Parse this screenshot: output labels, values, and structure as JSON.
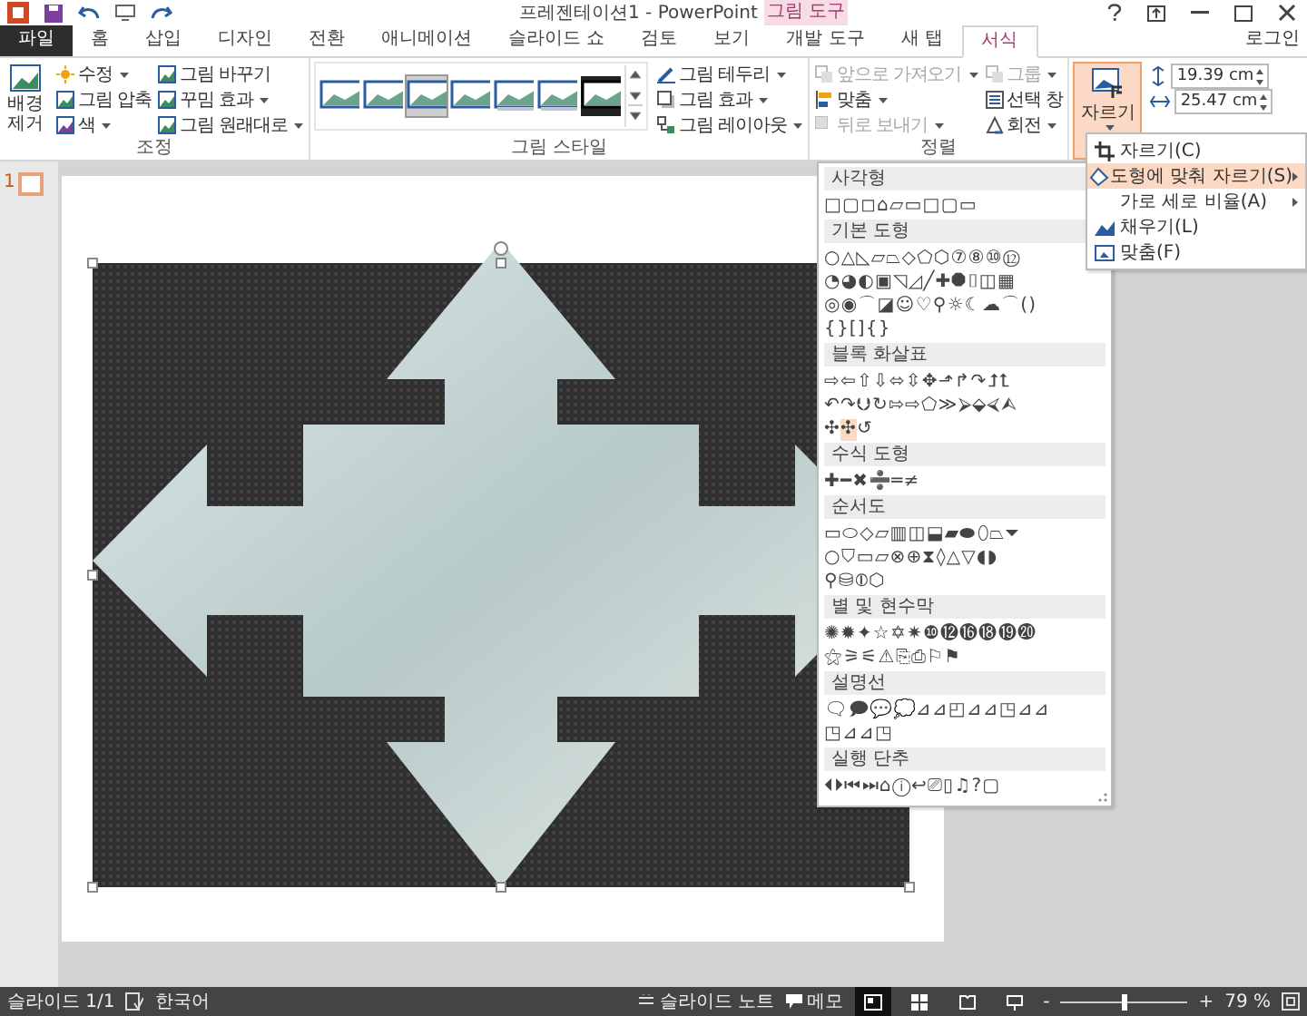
{
  "title_bar": {
    "title": "프레젠테이션1 - PowerPoint",
    "context_group": "그림 도구"
  },
  "tabs": [
    {
      "label": "파일",
      "kind": "file",
      "selected": false
    },
    {
      "label": "홈",
      "kind": "tab",
      "selected": false
    },
    {
      "label": "삽입",
      "kind": "tab",
      "selected": false
    },
    {
      "label": "디자인",
      "kind": "tab",
      "selected": false
    },
    {
      "label": "전환",
      "kind": "tab",
      "selected": false
    },
    {
      "label": "애니메이션",
      "kind": "tab",
      "selected": false
    },
    {
      "label": "슬라이드 쇼",
      "kind": "tab",
      "selected": false
    },
    {
      "label": "검토",
      "kind": "tab",
      "selected": false
    },
    {
      "label": "보기",
      "kind": "tab",
      "selected": false
    },
    {
      "label": "개발 도구",
      "kind": "tab",
      "selected": false
    },
    {
      "label": "새 탭",
      "kind": "tab",
      "selected": false
    },
    {
      "label": "서식",
      "kind": "context",
      "selected": true
    }
  ],
  "account": "로그인",
  "adjust": {
    "title": "조정",
    "big_button": "배경 제거",
    "items": [
      {
        "label": "수정",
        "kind": "sun",
        "dropdown": true
      },
      {
        "label": "그림 압축",
        "kind": "compress",
        "dropdown": false
      },
      {
        "label": "색",
        "kind": "color",
        "dropdown": true
      },
      {
        "label": "그림 바꾸기",
        "kind": "change",
        "dropdown": false
      },
      {
        "label": "꾸밈 효과",
        "kind": "effect",
        "dropdown": true
      },
      {
        "label": "그림 원래대로",
        "kind": "reset",
        "dropdown": true
      }
    ]
  },
  "styles": {
    "title": "그림 스타일",
    "gallery": [
      {
        "kind": "shadow",
        "selected": false
      },
      {
        "kind": "frame",
        "selected": false
      },
      {
        "kind": "grey",
        "selected": true
      },
      {
        "kind": "soft",
        "selected": false
      },
      {
        "kind": "reflect",
        "selected": false
      },
      {
        "kind": "reflect",
        "selected": false
      },
      {
        "kind": "black",
        "selected": false
      }
    ],
    "items": [
      {
        "label": "그림 테두리",
        "kind": "pen",
        "dropdown": true
      },
      {
        "label": "그림 효과",
        "kind": "effect",
        "dropdown": true
      },
      {
        "label": "그림 레이아웃",
        "kind": "layout",
        "dropdown": true
      }
    ]
  },
  "arrange": {
    "title": "정렬",
    "items": [
      {
        "label": "앞으로 가져오기",
        "kind": "front",
        "dropdown": true,
        "disabled": true
      },
      {
        "label": "맞춤",
        "kind": "align",
        "dropdown": true,
        "disabled": false
      },
      {
        "label": "뒤로 보내기",
        "kind": "back",
        "dropdown": true,
        "disabled": true
      },
      {
        "label": "그룹",
        "kind": "group",
        "dropdown": true,
        "disabled": true
      },
      {
        "label": "선택 창",
        "kind": "pane",
        "dropdown": false,
        "disabled": false
      },
      {
        "label": "회전",
        "kind": "rotate",
        "dropdown": true,
        "disabled": false
      }
    ]
  },
  "size": {
    "crop_button": {
      "label": "자르기",
      "selected": true
    },
    "height": "19.39 cm",
    "width": "25.47 cm"
  },
  "crop_menu": [
    {
      "label": "자르기(C)",
      "kind": "crop",
      "submenu": false,
      "selected": false
    },
    {
      "label": "도형에 맞춰 자르기(S)",
      "kind": "shape",
      "submenu": true,
      "selected": true
    },
    {
      "label": "가로 세로 비율(A)",
      "kind": "none",
      "submenu": true,
      "selected": false
    },
    {
      "label": "채우기(L)",
      "kind": "fill",
      "submenu": false,
      "selected": false
    },
    {
      "label": "맞춤(F)",
      "kind": "fit",
      "submenu": false,
      "selected": false
    }
  ],
  "shape_menu": [
    {
      "title": "사각형",
      "rows": [
        [
          {
            "glyphs": "□▢◻⌂▱▭□▢▭",
            "selected": false
          }
        ]
      ]
    },
    {
      "title": "기본 도형",
      "rows": [
        [
          {
            "glyphs": "○△◺▱⏢◇⬠⬡⑦⑧⑩⑫",
            "selected": false
          }
        ],
        [
          {
            "glyphs": "◔◕◐▣◹◿╱✚⯃⌷◫▦",
            "selected": false
          }
        ],
        [
          {
            "glyphs": "◎◉⌒◪☺♡⚲☼☾☁⌒()",
            "selected": false
          }
        ],
        [
          {
            "glyphs": "{}[]{}",
            "selected": false
          }
        ]
      ]
    },
    {
      "title": "블록 화살표",
      "rows": [
        [
          {
            "glyphs": "⇨⇦⇧⇩⬄⇳✥⬏↱↷⮥⮤",
            "selected": false
          }
        ],
        [
          {
            "glyphs": "↶↷⮋↻⇰⇨⬠≫⮚⬙⮘⮙",
            "selected": false
          }
        ],
        [
          {
            "glyphs": "✣",
            "selected": false
          },
          {
            "glyphs": "✣",
            "selected": true
          },
          {
            "glyphs": "↺",
            "selected": false
          }
        ]
      ]
    },
    {
      "title": "수식 도형",
      "rows": [
        [
          {
            "glyphs": "✚━✖➗═≠",
            "selected": false
          }
        ]
      ]
    },
    {
      "title": "순서도",
      "rows": [
        [
          {
            "glyphs": "▭⬭◇▱▥◫⬓▰⬬⬯⏢⏷",
            "selected": false
          }
        ],
        [
          {
            "glyphs": "○⛉▭⏥⊗⊕⧗◊△▽◖◗",
            "selected": false
          }
        ],
        [
          {
            "glyphs": "⚲⛁⦶⬡",
            "selected": false
          }
        ]
      ]
    },
    {
      "title": "별 및 현수막",
      "rows": [
        [
          {
            "glyphs": "✺✹✦☆✡✷❿⓬⓰⓲⓳⓴",
            "selected": false
          }
        ],
        [
          {
            "glyphs": "⚝⚞⚟⚠⎘⎙⚐⚑",
            "selected": false
          }
        ]
      ]
    },
    {
      "title": "설명선",
      "rows": [
        [
          {
            "glyphs": "🗨🗩💬💭⊿⊿◰⊿⊿◳⊿⊿",
            "selected": false
          }
        ],
        [
          {
            "glyphs": "◳⊿⊿◳",
            "selected": false
          }
        ]
      ]
    },
    {
      "title": "실행 단추",
      "rows": [
        [
          {
            "glyphs": "⏴⏵⏮⏭⌂ⓘ↩⎚▯♫?▢",
            "selected": false
          }
        ]
      ]
    }
  ],
  "slide_pane": {
    "number": "1"
  },
  "status_bar": {
    "slide": "슬라이드 1/1",
    "language": "한국어",
    "notes": "슬라이드 노트",
    "comments": "메모",
    "views": [
      {
        "kind": "normal",
        "selected": true
      },
      {
        "kind": "sorter",
        "selected": false
      },
      {
        "kind": "reading",
        "selected": false
      },
      {
        "kind": "show",
        "selected": false
      }
    ],
    "zoom": {
      "zoom_out": "-",
      "zoom_in": "+",
      "level": 0.5,
      "reading": "79 %"
    }
  }
}
